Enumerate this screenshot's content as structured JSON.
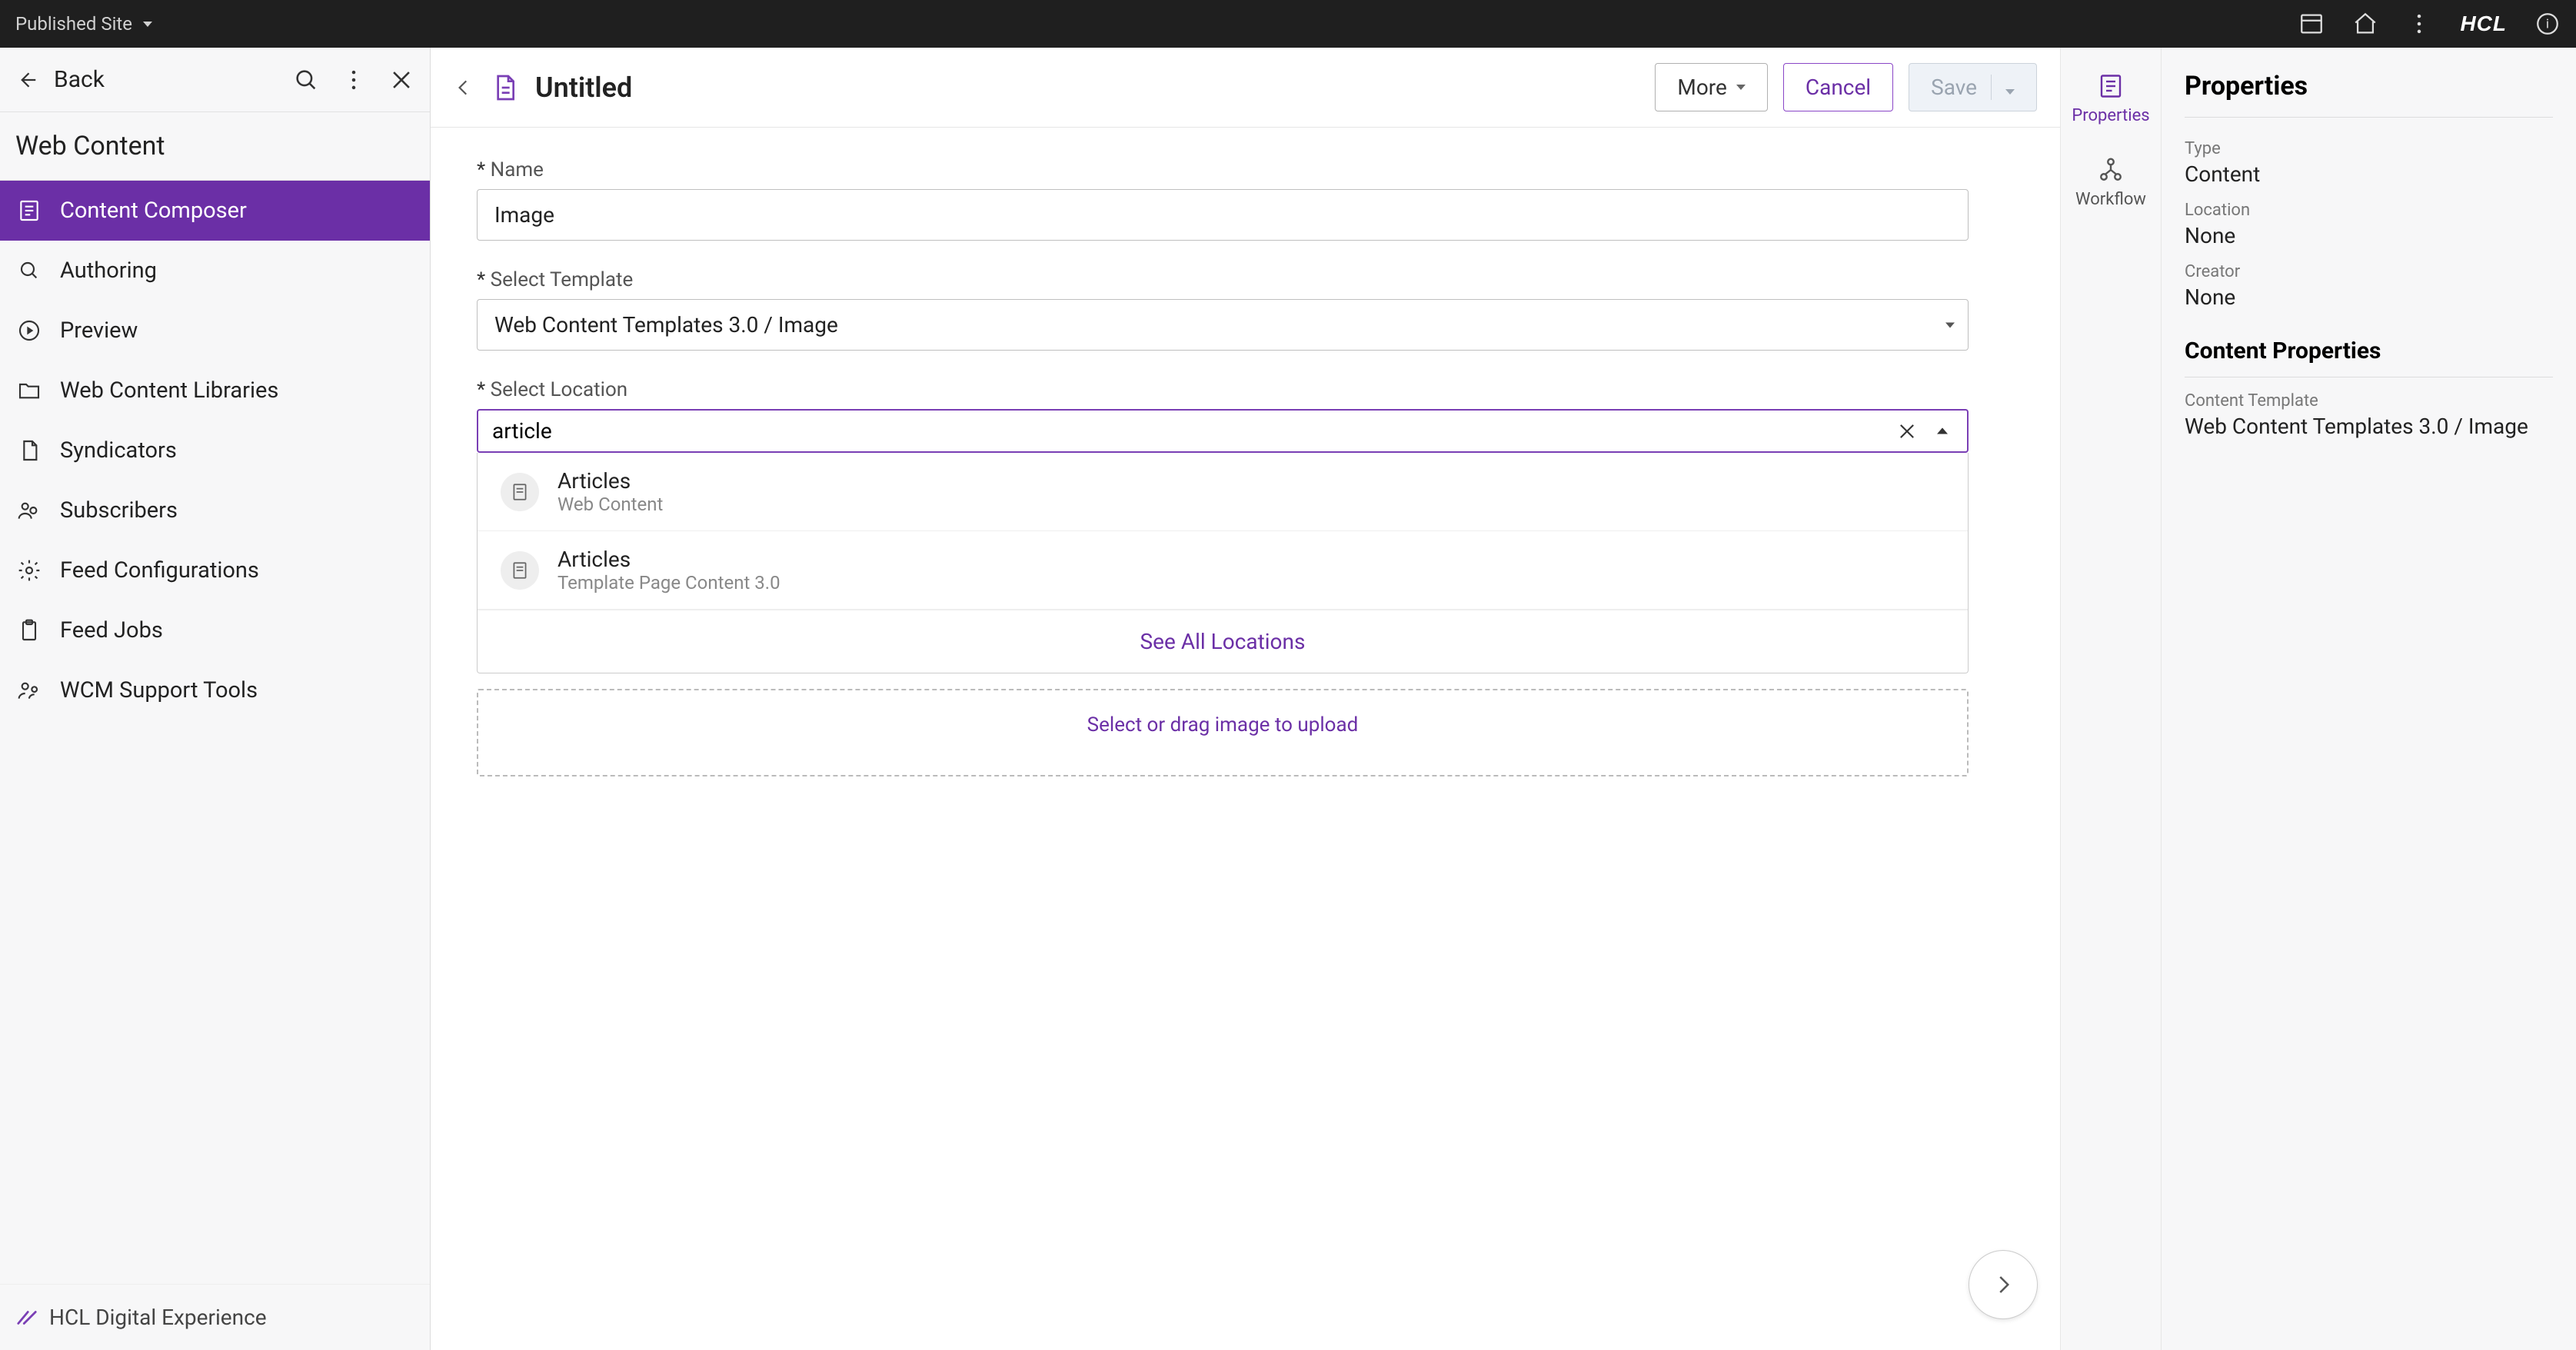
{
  "topbar": {
    "site_label": "Published Site"
  },
  "sidebar": {
    "back_label": "Back",
    "title": "Web Content",
    "items": [
      {
        "label": "Content Composer"
      },
      {
        "label": "Authoring"
      },
      {
        "label": "Preview"
      },
      {
        "label": "Web Content Libraries"
      },
      {
        "label": "Syndicators"
      },
      {
        "label": "Subscribers"
      },
      {
        "label": "Feed Configurations"
      },
      {
        "label": "Feed Jobs"
      },
      {
        "label": "WCM Support Tools"
      }
    ],
    "footer_product": "HCL Digital Experience"
  },
  "toolbar": {
    "doc_title": "Untitled",
    "more_label": "More",
    "cancel_label": "Cancel",
    "save_label": "Save"
  },
  "form": {
    "name_label": "Name",
    "name_value": "Image",
    "template_label": "Select Template",
    "template_value": "Web Content Templates 3.0 / Image",
    "location_label": "Select Location",
    "location_value": "article",
    "location_options": [
      {
        "title": "Articles",
        "subtitle": "Web Content"
      },
      {
        "title": "Articles",
        "subtitle": "Template Page Content 3.0"
      }
    ],
    "see_all_label": "See All Locations",
    "upload_hint": "Select or drag image to upload"
  },
  "rail": {
    "tabs": {
      "properties": "Properties",
      "workflow": "Workflow"
    },
    "panel_title": "Properties",
    "type_label": "Type",
    "type_value": "Content",
    "location_label": "Location",
    "location_value": "None",
    "creator_label": "Creator",
    "creator_value": "None",
    "content_props_title": "Content Properties",
    "ct_label": "Content Template",
    "ct_value": "Web Content Templates 3.0 / Image"
  }
}
